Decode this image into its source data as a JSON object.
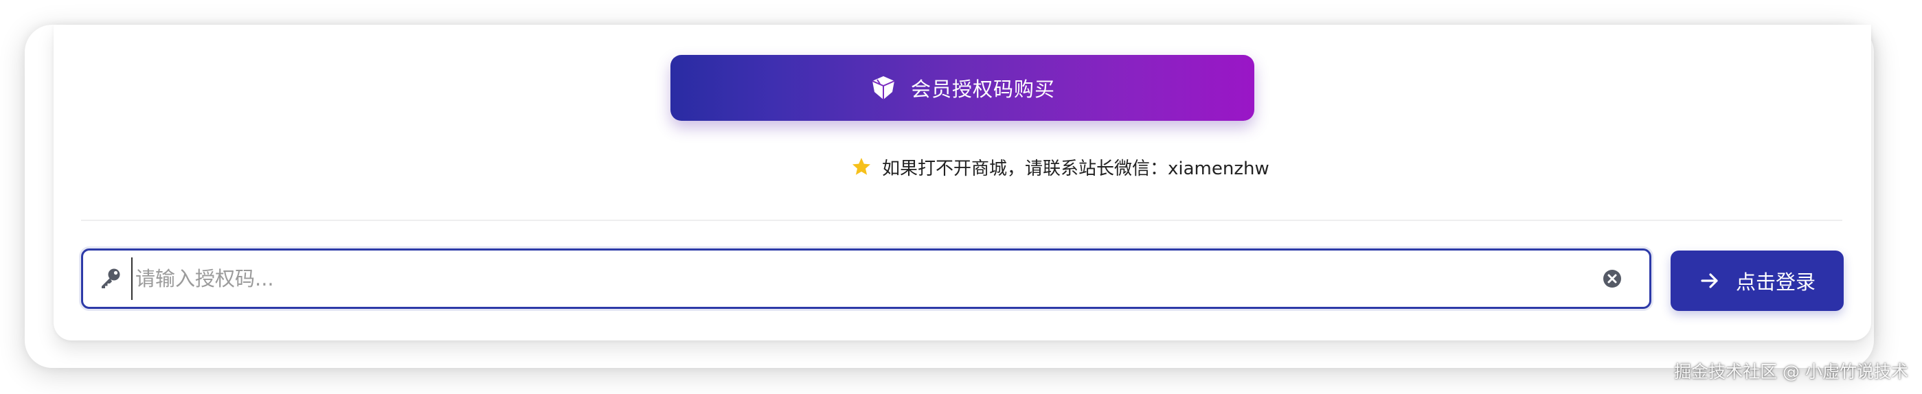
{
  "purchase": {
    "label": "会员授权码购买",
    "icon": "diamond-icon",
    "gradient_start": "#2a2ca3",
    "gradient_end": "#9a16c6"
  },
  "notice": {
    "icon": "star-icon",
    "text": "如果打不开商城，请联系站长微信：xiamenzhw",
    "star_color": "#f6c01b"
  },
  "auth_input": {
    "icon": "key-icon",
    "placeholder": "请输入授权码...",
    "value": "",
    "clear_icon": "clear-icon",
    "border_color": "#2d3aa8"
  },
  "login": {
    "icon": "arrow-right-icon",
    "label": "点击登录",
    "color": "#2c31a8"
  },
  "watermark": {
    "text": "掘金技术社区 @ 小虚竹说技术"
  }
}
